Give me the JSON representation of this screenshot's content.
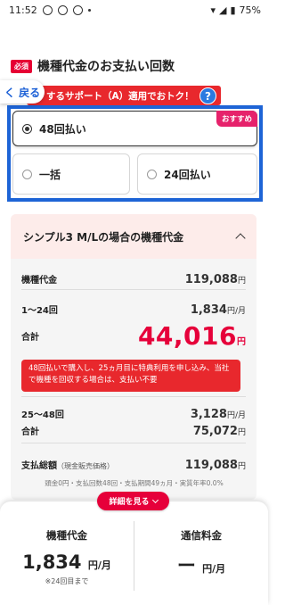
{
  "status_bar": {
    "time": "11:52",
    "battery": "75%"
  },
  "section": {
    "badge": "必須",
    "title": "機種代金のお支払い回数"
  },
  "nav": {
    "back_label": "く 戻る"
  },
  "promo": {
    "text": "するサポート（A）適用でおトク！",
    "help_label": "?"
  },
  "options": [
    {
      "label": "48回払い",
      "selected": true,
      "badge": "おすすめ"
    },
    {
      "label": "一括",
      "selected": false
    },
    {
      "label": "24回払い",
      "selected": false
    }
  ],
  "card": {
    "title": "シンプル3 M/Lの場合の機種代金",
    "device_price": {
      "label": "機種代金",
      "value": "119,088",
      "unit": "円"
    },
    "months_1_24": {
      "label": "1〜24回",
      "value": "1,834",
      "unit": "円/月"
    },
    "subtotal_1": {
      "label": "合計",
      "value": "44,016",
      "unit": "円"
    },
    "notice": "48回払いで購入し、25ヵ月目に特典利用を申し込み、当社で機種を回収する場合は、支払い不要",
    "months_25_48": {
      "label": "25〜48回",
      "value": "3,128",
      "unit": "円/月"
    },
    "subtotal_2": {
      "label": "合計",
      "value": "75,072",
      "unit": "円"
    },
    "grand_total": {
      "label": "支払総額",
      "sub": "（現金販売価格）",
      "value": "119,088",
      "unit": "円"
    }
  },
  "footnote": "頭金0円・支払回数48回・支払期間49ヵ月・実質年率0.0%",
  "detail_button": "詳細を見る",
  "bottom": {
    "device": {
      "title": "機種代金",
      "value": "1,834",
      "unit": "円/月",
      "note": "※24回目まで"
    },
    "service": {
      "title": "通信料金",
      "value": "ー",
      "unit": "円/月"
    }
  },
  "colors": {
    "accent_red": "#e6003a",
    "banner_red": "#e8282d",
    "highlight_blue": "#1d64d6",
    "pink_badge": "#e6226b"
  }
}
